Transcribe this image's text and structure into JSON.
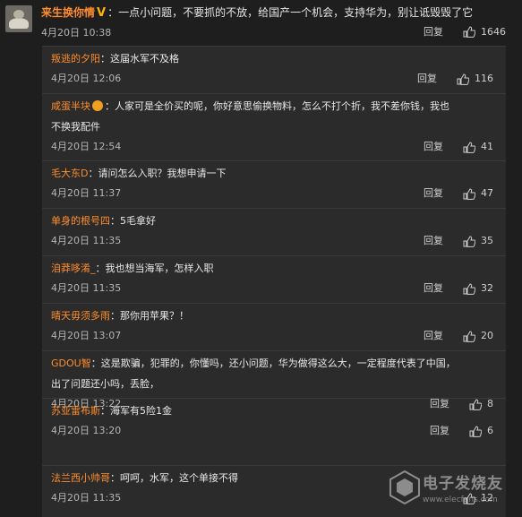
{
  "top_comment": {
    "username": "来生换你情",
    "verified_badge": "V",
    "text": "：一点小问题，不要抓的不放，给国产一个机会，支持华为，别让诋毁毁了它",
    "time": "4月20日 10:38",
    "reply_label": "回复",
    "likes": "1646"
  },
  "replies": [
    {
      "name": "叛逃的夕阳",
      "text": "：这届水军不及格",
      "time": "4月20日 12:06",
      "reply_label": "回复",
      "likes": "116"
    },
    {
      "name": "咸蛋半块",
      "text": "：人家可是全价买的呢，你好意思偷换物料，怎么不打个折，我不差你钱，我也",
      "text2": "不换我配件",
      "time": "4月20日 12:54",
      "reply_label": "回复",
      "likes": "41"
    },
    {
      "name": "毛大东D",
      "text": "：请问怎么入职？我想申请一下",
      "time": "4月20日 11:37",
      "reply_label": "回复",
      "likes": "47"
    },
    {
      "name": "单身的根号四",
      "text": "：5毛拿好",
      "time": "4月20日 11:35",
      "reply_label": "回复",
      "likes": "35"
    },
    {
      "name": "洎莽哆淆_",
      "text": "：我也想当海军，怎样入职",
      "time": "4月20日 11:35",
      "reply_label": "回复",
      "likes": "32"
    },
    {
      "name": "晴天毋须多雨",
      "text": "：那你用苹果？！",
      "time": "4月20日 13:07",
      "reply_label": "回复",
      "likes": "20"
    },
    {
      "name": "GDOU智",
      "text": "：这是欺骗，犯罪的，你懂吗，还小问题，华为做得这么大，一定程度代表了中国，",
      "text2": "出了问题还小吗，丢脸，",
      "time": "4月20日 13:22",
      "reply_label": "回复",
      "likes": "8"
    },
    {
      "name": "苏亚雷布斯",
      "text": "：海军有5险1金",
      "time": "4月20日 13:20",
      "reply_label": "回复",
      "likes": "6"
    },
    {
      "name": "法兰西小帅哥",
      "text": "：呵呵，水军，这个单接不得",
      "time": "4月20日 11:35",
      "reply_label": "",
      "likes": "12"
    }
  ],
  "watermark": {
    "line1": "电子发烧友",
    "line2": "www.elecfans.com"
  },
  "colors": {
    "background": "#1e1e1e",
    "panel": "#2b2b2b",
    "username": "#ff8d2e",
    "badge": "#ffb400"
  }
}
